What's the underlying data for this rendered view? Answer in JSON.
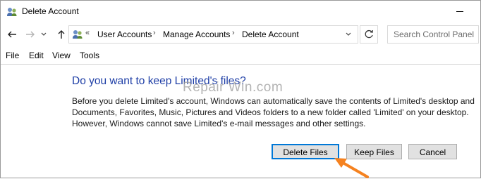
{
  "window": {
    "title": "Delete Account"
  },
  "nav": {
    "back_icon": "back-arrow-icon",
    "forward_icon": "forward-arrow-icon",
    "up_icon": "up-arrow-icon"
  },
  "address": {
    "overflow": "«",
    "breadcrumbs": [
      "User Accounts",
      "Manage Accounts",
      "Delete Account"
    ],
    "separator": "›"
  },
  "search": {
    "placeholder": "Search Control Panel"
  },
  "menu": {
    "items": [
      "File",
      "Edit",
      "View",
      "Tools"
    ]
  },
  "dialog": {
    "heading": "Do you want to keep Limited's files?",
    "lines": [
      "Before you delete Limited's account, Windows can automatically save the contents of Limited's desktop and",
      "Documents, Favorites, Music, Pictures and Videos folders to a new folder called 'Limited' on your desktop.",
      "However, Windows cannot save Limited's e-mail messages and other settings."
    ],
    "watermark": "Repair Win.com"
  },
  "buttons": {
    "delete": "Delete Files",
    "keep": "Keep Files",
    "cancel": "Cancel"
  },
  "colors": {
    "heading": "#1e3ea6",
    "focus_border": "#0078d7",
    "annotation_arrow": "#f58220"
  }
}
